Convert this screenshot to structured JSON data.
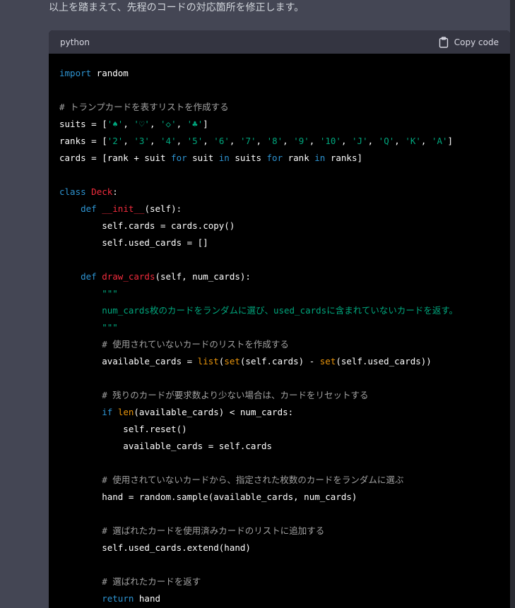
{
  "intro_text": "以上を踏まえて、先程のコードの対応箇所を修正します。",
  "code_block": {
    "language": "python",
    "copy_label": "Copy code"
  },
  "colors": {
    "page_bg": "#444654",
    "header_bg": "#343541",
    "code_bg": "#000000",
    "keyword": "#2e95d3",
    "function_name": "#f22c3d",
    "builtin": "#e9950c",
    "string": "#00a67d",
    "comment": "#a1a1a1",
    "plain": "#ffffff"
  },
  "code_lines": [
    [
      {
        "t": "kw",
        "v": "import"
      },
      {
        "t": "p",
        "v": " random"
      }
    ],
    [],
    [
      {
        "t": "cm",
        "v": "# トランプカードを表すリストを作成する"
      }
    ],
    [
      {
        "t": "p",
        "v": "suits = ["
      },
      {
        "t": "str",
        "v": "'♠'"
      },
      {
        "t": "p",
        "v": ", "
      },
      {
        "t": "str",
        "v": "'♡'"
      },
      {
        "t": "p",
        "v": ", "
      },
      {
        "t": "str",
        "v": "'◇'"
      },
      {
        "t": "p",
        "v": ", "
      },
      {
        "t": "str",
        "v": "'♣'"
      },
      {
        "t": "p",
        "v": "]"
      }
    ],
    [
      {
        "t": "p",
        "v": "ranks = ["
      },
      {
        "t": "str",
        "v": "'2'"
      },
      {
        "t": "p",
        "v": ", "
      },
      {
        "t": "str",
        "v": "'3'"
      },
      {
        "t": "p",
        "v": ", "
      },
      {
        "t": "str",
        "v": "'4'"
      },
      {
        "t": "p",
        "v": ", "
      },
      {
        "t": "str",
        "v": "'5'"
      },
      {
        "t": "p",
        "v": ", "
      },
      {
        "t": "str",
        "v": "'6'"
      },
      {
        "t": "p",
        "v": ", "
      },
      {
        "t": "str",
        "v": "'7'"
      },
      {
        "t": "p",
        "v": ", "
      },
      {
        "t": "str",
        "v": "'8'"
      },
      {
        "t": "p",
        "v": ", "
      },
      {
        "t": "str",
        "v": "'9'"
      },
      {
        "t": "p",
        "v": ", "
      },
      {
        "t": "str",
        "v": "'10'"
      },
      {
        "t": "p",
        "v": ", "
      },
      {
        "t": "str",
        "v": "'J'"
      },
      {
        "t": "p",
        "v": ", "
      },
      {
        "t": "str",
        "v": "'Q'"
      },
      {
        "t": "p",
        "v": ", "
      },
      {
        "t": "str",
        "v": "'K'"
      },
      {
        "t": "p",
        "v": ", "
      },
      {
        "t": "str",
        "v": "'A'"
      },
      {
        "t": "p",
        "v": "]"
      }
    ],
    [
      {
        "t": "p",
        "v": "cards = [rank + suit "
      },
      {
        "t": "kw",
        "v": "for"
      },
      {
        "t": "p",
        "v": " suit "
      },
      {
        "t": "kw",
        "v": "in"
      },
      {
        "t": "p",
        "v": " suits "
      },
      {
        "t": "kw",
        "v": "for"
      },
      {
        "t": "p",
        "v": " rank "
      },
      {
        "t": "kw",
        "v": "in"
      },
      {
        "t": "p",
        "v": " ranks]"
      }
    ],
    [],
    [
      {
        "t": "kw",
        "v": "class"
      },
      {
        "t": "p",
        "v": " "
      },
      {
        "t": "fn",
        "v": "Deck"
      },
      {
        "t": "p",
        "v": ":"
      }
    ],
    [
      {
        "t": "p",
        "v": "    "
      },
      {
        "t": "kw",
        "v": "def"
      },
      {
        "t": "p",
        "v": " "
      },
      {
        "t": "fn",
        "v": "__init__"
      },
      {
        "t": "p",
        "v": "(self):"
      }
    ],
    [
      {
        "t": "p",
        "v": "        self.cards = cards.copy()"
      }
    ],
    [
      {
        "t": "p",
        "v": "        self.used_cards = []"
      }
    ],
    [],
    [
      {
        "t": "p",
        "v": "    "
      },
      {
        "t": "kw",
        "v": "def"
      },
      {
        "t": "p",
        "v": " "
      },
      {
        "t": "fn",
        "v": "draw_cards"
      },
      {
        "t": "p",
        "v": "(self, num_cards):"
      }
    ],
    [
      {
        "t": "p",
        "v": "        "
      },
      {
        "t": "str",
        "v": "\"\"\""
      }
    ],
    [
      {
        "t": "p",
        "v": "        "
      },
      {
        "t": "str",
        "v": "num_cards枚のカードをランダムに選び、used_cardsに含まれていないカードを返す。"
      }
    ],
    [
      {
        "t": "p",
        "v": "        "
      },
      {
        "t": "str",
        "v": "\"\"\""
      }
    ],
    [
      {
        "t": "p",
        "v": "        "
      },
      {
        "t": "cm",
        "v": "# 使用されていないカードのリストを作成する"
      }
    ],
    [
      {
        "t": "p",
        "v": "        available_cards = "
      },
      {
        "t": "bi",
        "v": "list"
      },
      {
        "t": "p",
        "v": "("
      },
      {
        "t": "bi",
        "v": "set"
      },
      {
        "t": "p",
        "v": "(self.cards) - "
      },
      {
        "t": "bi",
        "v": "set"
      },
      {
        "t": "p",
        "v": "(self.used_cards))"
      }
    ],
    [],
    [
      {
        "t": "p",
        "v": "        "
      },
      {
        "t": "cm",
        "v": "# 残りのカードが要求数より少ない場合は、カードをリセットする"
      }
    ],
    [
      {
        "t": "p",
        "v": "        "
      },
      {
        "t": "kw",
        "v": "if"
      },
      {
        "t": "p",
        "v": " "
      },
      {
        "t": "bi",
        "v": "len"
      },
      {
        "t": "p",
        "v": "(available_cards) < num_cards:"
      }
    ],
    [
      {
        "t": "p",
        "v": "            self.reset()"
      }
    ],
    [
      {
        "t": "p",
        "v": "            available_cards = self.cards"
      }
    ],
    [],
    [
      {
        "t": "p",
        "v": "        "
      },
      {
        "t": "cm",
        "v": "# 使用されていないカードから、指定された枚数のカードをランダムに選ぶ"
      }
    ],
    [
      {
        "t": "p",
        "v": "        hand = random.sample(available_cards, num_cards)"
      }
    ],
    [],
    [
      {
        "t": "p",
        "v": "        "
      },
      {
        "t": "cm",
        "v": "# 選ばれたカードを使用済みカードのリストに追加する"
      }
    ],
    [
      {
        "t": "p",
        "v": "        self.used_cards.extend(hand)"
      }
    ],
    [],
    [
      {
        "t": "p",
        "v": "        "
      },
      {
        "t": "cm",
        "v": "# 選ばれたカードを返す"
      }
    ],
    [
      {
        "t": "p",
        "v": "        "
      },
      {
        "t": "kw",
        "v": "return"
      },
      {
        "t": "p",
        "v": " hand"
      }
    ]
  ]
}
